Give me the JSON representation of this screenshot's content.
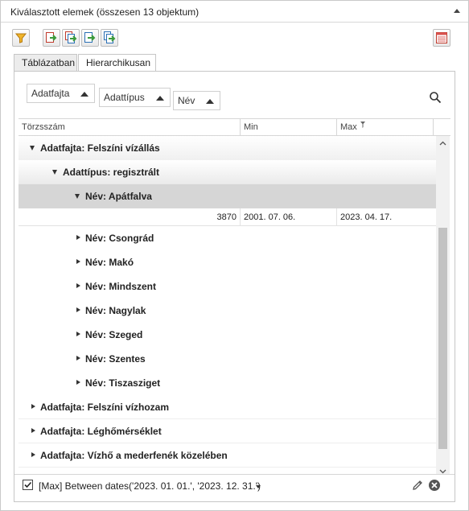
{
  "panel": {
    "title": "Kiválasztott elemek (összesen 13 objektum)"
  },
  "toolbar": {
    "buttons": [
      "filter-icon",
      "export-icon",
      "export-all-icon",
      "import-icon",
      "import-all-icon"
    ],
    "right_button": "table-settings-icon"
  },
  "tabs": [
    {
      "label": "Táblázatban",
      "active": false
    },
    {
      "label": "Hierarchikusan",
      "active": true
    }
  ],
  "grouping": {
    "chips": [
      "Adatfajta",
      "Adattípus",
      "Név"
    ]
  },
  "grid": {
    "columns": [
      "Törzsszám",
      "Min",
      "Max"
    ],
    "rows": [
      {
        "level": 1,
        "expanded": true,
        "label": "Adatfajta: Felszíni vízállás"
      },
      {
        "level": 2,
        "expanded": true,
        "label": "Adattípus: regisztrált"
      },
      {
        "level": 3,
        "expanded": true,
        "label": "Név: Apátfalva",
        "selected": true
      },
      {
        "data": {
          "torzsszam": "3870",
          "min": "2001. 07. 06.",
          "max": "2023. 04. 17."
        }
      },
      {
        "level": 3,
        "expanded": false,
        "label": "Név: Csongrád"
      },
      {
        "level": 3,
        "expanded": false,
        "label": "Név: Makó"
      },
      {
        "level": 3,
        "expanded": false,
        "label": "Név: Mindszent"
      },
      {
        "level": 3,
        "expanded": false,
        "label": "Név: Nagylak"
      },
      {
        "level": 3,
        "expanded": false,
        "label": "Név: Szeged"
      },
      {
        "level": 3,
        "expanded": false,
        "label": "Név: Szentes"
      },
      {
        "level": 3,
        "expanded": false,
        "label": "Név: Tiszasziget"
      },
      {
        "level": 1,
        "expanded": false,
        "label": "Adatfajta: Felszíni vízhozam"
      },
      {
        "level": 1,
        "expanded": false,
        "label": "Adatfajta: Léghőmérséklet"
      },
      {
        "level": 1,
        "expanded": false,
        "label": "Adatfajta: Vízhő a mederfenék közelében"
      }
    ]
  },
  "footer": {
    "checked": true,
    "filter_text": "[Max] Between dates('2023. 01. 01.', '2023. 12. 31.')"
  },
  "colors": {
    "accent_orange": "#e8a33a",
    "selected_row": "#d6d6d6"
  }
}
